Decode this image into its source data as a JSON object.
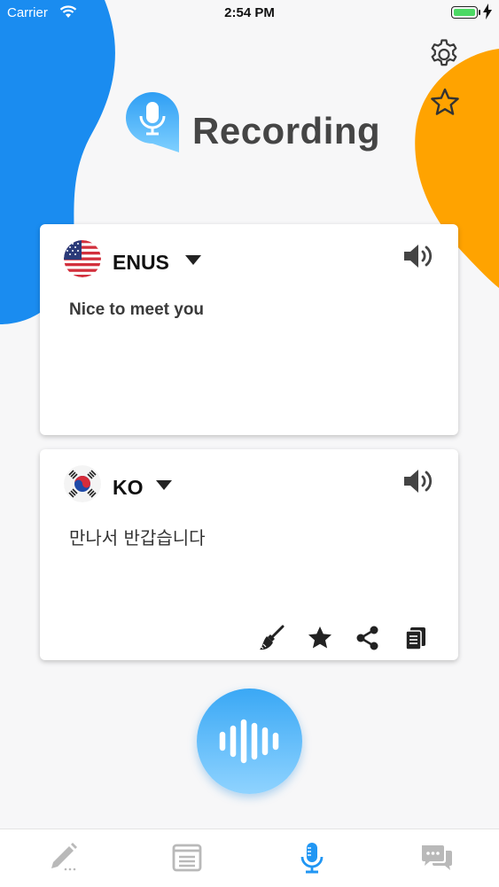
{
  "status": {
    "carrier": "Carrier",
    "time": "2:54 PM",
    "battery_level": 1.0
  },
  "header": {
    "title": "Recording",
    "settings_icon": "gear-icon",
    "favorites_icon": "star-icon"
  },
  "colors": {
    "blue_blob": "#1a8cf0",
    "orange_blob": "#ffa300",
    "accent": "#2196f3",
    "mic_gradient_top": "#3aa8f5",
    "mic_gradient_bottom": "#8fd3ff"
  },
  "source": {
    "lang_code": "ENUS",
    "flag": "us-flag",
    "text": "Nice to meet you"
  },
  "target": {
    "lang_code": "KO",
    "flag": "kr-flag",
    "text": "만나서 반갑습니다"
  },
  "target_actions": [
    "broom-icon",
    "star-icon",
    "share-icon",
    "copy-icon"
  ],
  "tabs": [
    {
      "icon": "pencil-icon",
      "active": false
    },
    {
      "icon": "list-icon",
      "active": false
    },
    {
      "icon": "microphone-icon",
      "active": true
    },
    {
      "icon": "chat-icon",
      "active": false
    }
  ]
}
